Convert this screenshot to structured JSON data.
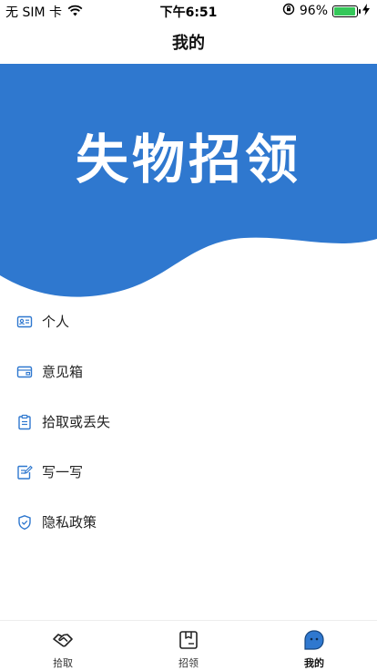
{
  "status_bar": {
    "carrier": "无 SIM 卡",
    "time": "下午6:51",
    "battery_percent": "96%",
    "battery_level": 0.96,
    "wifi_icon": "wifi-icon",
    "lock_icon": "rotation-lock-icon",
    "charging_icon": "charging-bolt-icon"
  },
  "nav": {
    "title": "我的"
  },
  "hero": {
    "title": "失物招领",
    "color": "#2f78cf"
  },
  "menu": {
    "items": [
      {
        "label": "个人",
        "icon": "id-card-icon"
      },
      {
        "label": "意见箱",
        "icon": "inbox-icon"
      },
      {
        "label": "拾取或丢失",
        "icon": "clipboard-icon"
      },
      {
        "label": "写一写",
        "icon": "edit-note-icon"
      },
      {
        "label": "隐私政策",
        "icon": "shield-check-icon"
      }
    ],
    "icon_color": "#2f78cf"
  },
  "tab_bar": {
    "tabs": [
      {
        "label": "拾取",
        "icon": "handshake-icon",
        "active": false
      },
      {
        "label": "招领",
        "icon": "box-icon",
        "active": false
      },
      {
        "label": "我的",
        "icon": "profile-face-icon",
        "active": true
      }
    ]
  }
}
